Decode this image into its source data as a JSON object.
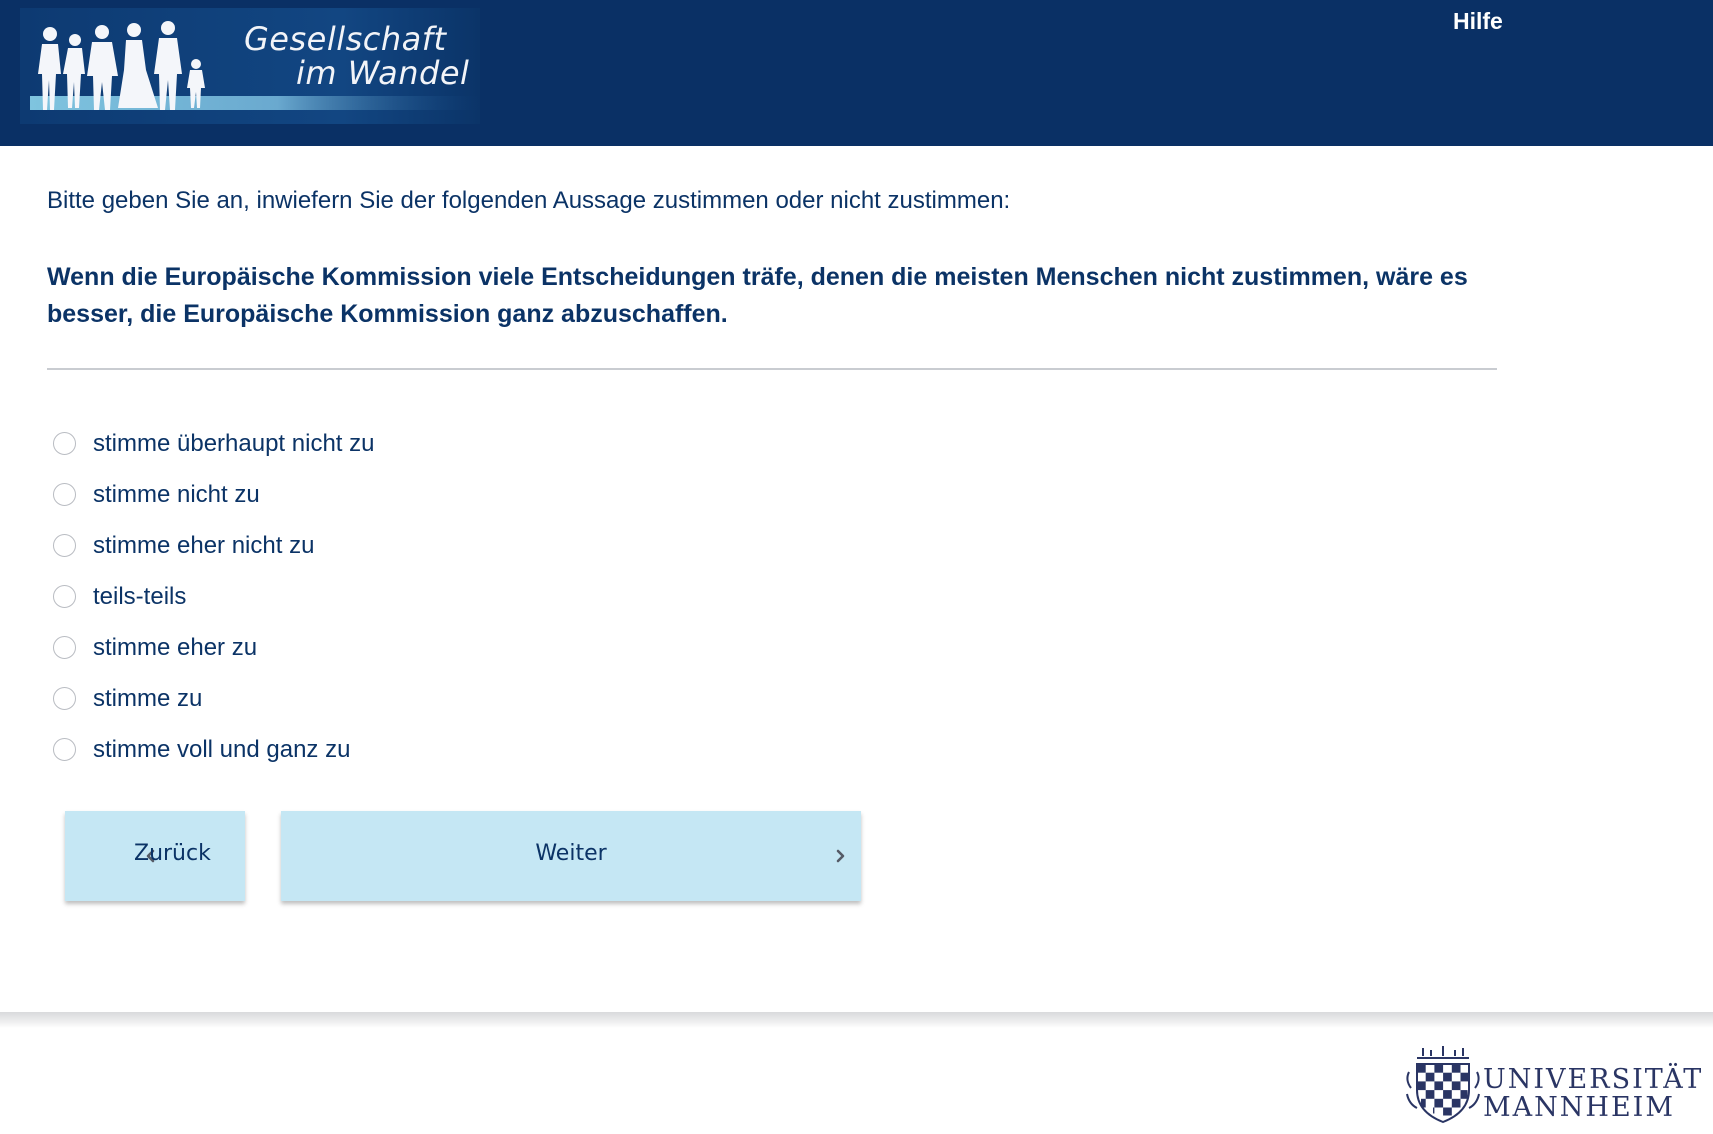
{
  "header": {
    "logo_line1": "Gesellschaft",
    "logo_line2": "im Wandel",
    "help_label": "Hilfe"
  },
  "question": {
    "intro": "Bitte geben Sie an, inwiefern Sie der folgenden Aussage zustimmen oder nicht zustimmen:",
    "statement": "Wenn die Europäische Kommission viele Entscheidungen träfe, denen die meisten Menschen nicht zustimmen, wäre es besser, die Europäische Kommission ganz abzuschaffen.",
    "options": [
      "stimme überhaupt nicht zu",
      "stimme nicht zu",
      "stimme eher nicht zu",
      "teils-teils",
      "stimme eher zu",
      "stimme zu",
      "stimme voll und ganz zu"
    ],
    "selected": null
  },
  "nav": {
    "back_label": "Zurück",
    "next_label": "Weiter"
  },
  "footer": {
    "university_line1": "UNIVERSITÄT",
    "university_line2": "MANNHEIM"
  },
  "colors": {
    "header_bg": "#0a3065",
    "text": "#0b3366",
    "button_bg": "#c5e7f4"
  },
  "icons": {
    "back": "chevron-left-icon",
    "next": "chevron-right-icon"
  }
}
